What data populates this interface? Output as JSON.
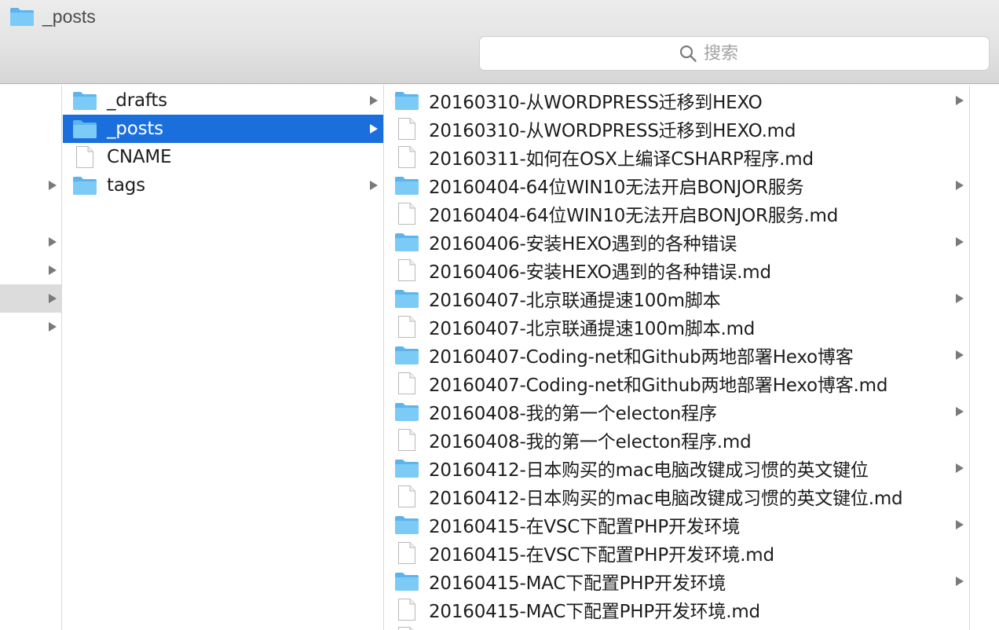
{
  "window": {
    "title": "_posts"
  },
  "search": {
    "placeholder": "搜索"
  },
  "colors": {
    "selection": "#1a6fdc",
    "folder": "#6cc1f3",
    "arrow": "#7a7a7a"
  },
  "columns": [
    {
      "items": [
        {
          "label": "",
          "type": "none",
          "arrow": false,
          "state": ""
        },
        {
          "label": "",
          "type": "none",
          "arrow": false,
          "state": ""
        },
        {
          "label": "",
          "type": "none",
          "arrow": false,
          "state": ""
        },
        {
          "label": "",
          "type": "none",
          "arrow": true,
          "state": ""
        },
        {
          "label": "",
          "type": "none",
          "arrow": false,
          "state": ""
        },
        {
          "label": "",
          "type": "none",
          "arrow": true,
          "state": ""
        },
        {
          "label": "",
          "type": "none",
          "arrow": true,
          "state": ""
        },
        {
          "label": "",
          "type": "none",
          "arrow": true,
          "state": "highlighted"
        },
        {
          "label": "",
          "type": "none",
          "arrow": true,
          "state": ""
        }
      ]
    },
    {
      "items": [
        {
          "label": "_drafts",
          "type": "folder",
          "arrow": true,
          "state": ""
        },
        {
          "label": "_posts",
          "type": "folder",
          "arrow": true,
          "state": "selected"
        },
        {
          "label": "CNAME",
          "type": "file",
          "arrow": false,
          "state": ""
        },
        {
          "label": "tags",
          "type": "folder",
          "arrow": true,
          "state": ""
        }
      ]
    },
    {
      "items": [
        {
          "label": "20160310-从WORDPRESS迁移到HEXO",
          "type": "folder",
          "arrow": true,
          "state": ""
        },
        {
          "label": "20160310-从WORDPRESS迁移到HEXO.md",
          "type": "file",
          "arrow": false,
          "state": ""
        },
        {
          "label": "20160311-如何在OSX上编译CSHARP程序.md",
          "type": "file",
          "arrow": false,
          "state": ""
        },
        {
          "label": "20160404-64位WIN10无法开启BONJOR服务",
          "type": "folder",
          "arrow": true,
          "state": ""
        },
        {
          "label": "20160404-64位WIN10无法开启BONJOR服务.md",
          "type": "file",
          "arrow": false,
          "state": ""
        },
        {
          "label": "20160406-安装HEXO遇到的各种错误",
          "type": "folder",
          "arrow": true,
          "state": ""
        },
        {
          "label": "20160406-安装HEXO遇到的各种错误.md",
          "type": "file",
          "arrow": false,
          "state": ""
        },
        {
          "label": "20160407-北京联通提速100m脚本",
          "type": "folder",
          "arrow": true,
          "state": ""
        },
        {
          "label": "20160407-北京联通提速100m脚本.md",
          "type": "file",
          "arrow": false,
          "state": ""
        },
        {
          "label": "20160407-Coding-net和Github两地部署Hexo博客",
          "type": "folder",
          "arrow": true,
          "state": ""
        },
        {
          "label": "20160407-Coding-net和Github两地部署Hexo博客.md",
          "type": "file",
          "arrow": false,
          "state": ""
        },
        {
          "label": "20160408-我的第一个electon程序",
          "type": "folder",
          "arrow": true,
          "state": ""
        },
        {
          "label": "20160408-我的第一个electon程序.md",
          "type": "file",
          "arrow": false,
          "state": ""
        },
        {
          "label": "20160412-日本购买的mac电脑改键成习惯的英文键位",
          "type": "folder",
          "arrow": true,
          "state": ""
        },
        {
          "label": "20160412-日本购买的mac电脑改键成习惯的英文键位.md",
          "type": "file",
          "arrow": false,
          "state": ""
        },
        {
          "label": "20160415-在VSC下配置PHP开发环境",
          "type": "folder",
          "arrow": true,
          "state": ""
        },
        {
          "label": "20160415-在VSC下配置PHP开发环境.md",
          "type": "file",
          "arrow": false,
          "state": ""
        },
        {
          "label": "20160415-MAC下配置PHP开发环境",
          "type": "folder",
          "arrow": true,
          "state": ""
        },
        {
          "label": "20160415-MAC下配置PHP开发环境.md",
          "type": "file",
          "arrow": false,
          "state": ""
        },
        {
          "label": "",
          "type": "file",
          "arrow": false,
          "state": ""
        }
      ]
    },
    {
      "items": []
    }
  ]
}
